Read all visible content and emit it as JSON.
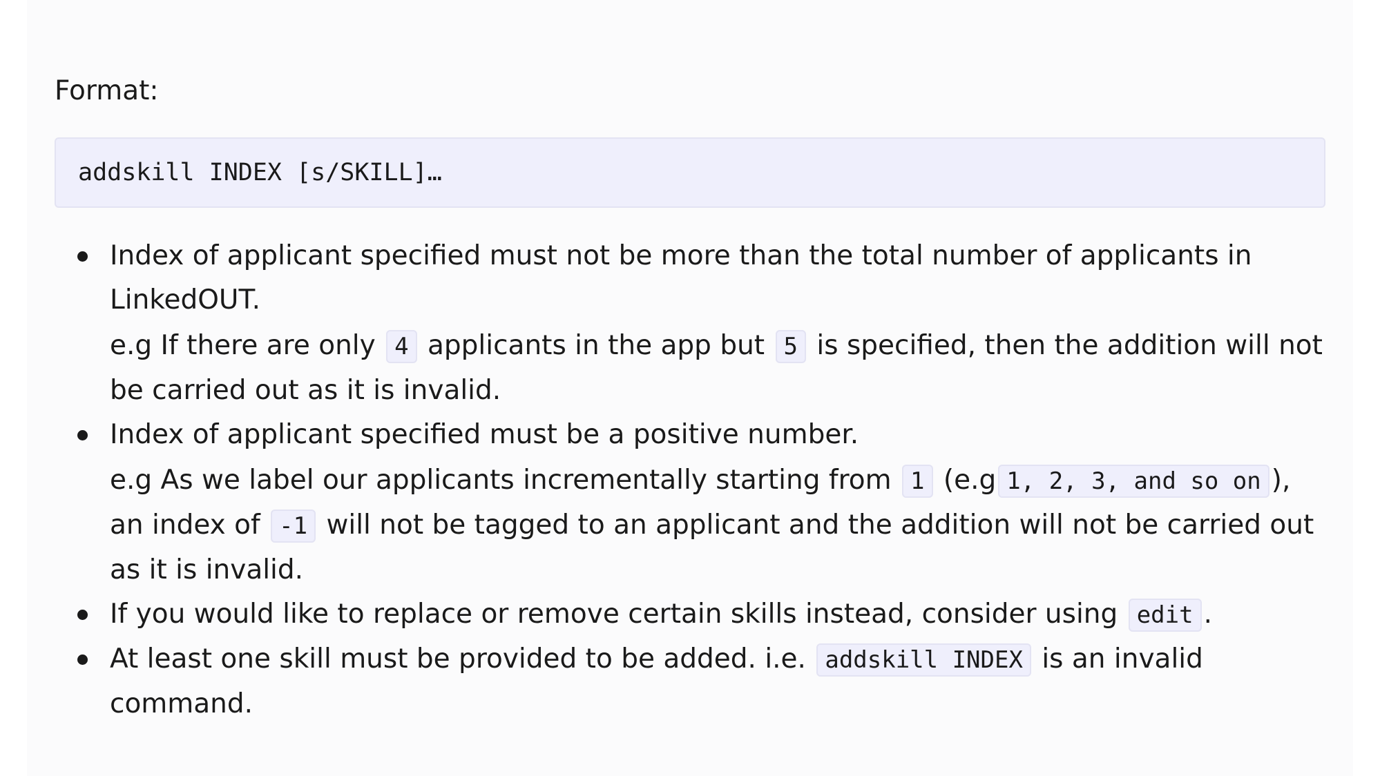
{
  "format_label": "Format:",
  "code_block": "addskill INDEX [s/SKILL]…",
  "notes": [
    {
      "main": "Index of applicant specified must not be more than the total number of applicants in LinkedOUT.",
      "ex_prefix": "e.g If there are only",
      "code_1": "4",
      "ex_mid": "applicants in the app but",
      "code_2": "5",
      "ex_suffix": "is specified, then the addition will not be carried out as it is invalid."
    },
    {
      "main": "Index of applicant specified must be a positive number.",
      "ex_prefix": "e.g As we label our applicants incrementally starting from",
      "code_1": "1",
      "ex_mid": "(e.g",
      "code_2": "1, 2, 3, and so on",
      "ex_mid2": "), an index of",
      "code_3": "-1",
      "ex_suffix": "will not be tagged to an applicant and the addition will not be carried out as it is invalid."
    },
    {
      "text": "If you would like to replace or remove certain skills instead, consider using",
      "code": "edit",
      "suffix": "."
    },
    {
      "text": "At least one skill must be provided to be added. i.e.",
      "code": "addskill INDEX",
      "suffix": "is an invalid command."
    }
  ]
}
